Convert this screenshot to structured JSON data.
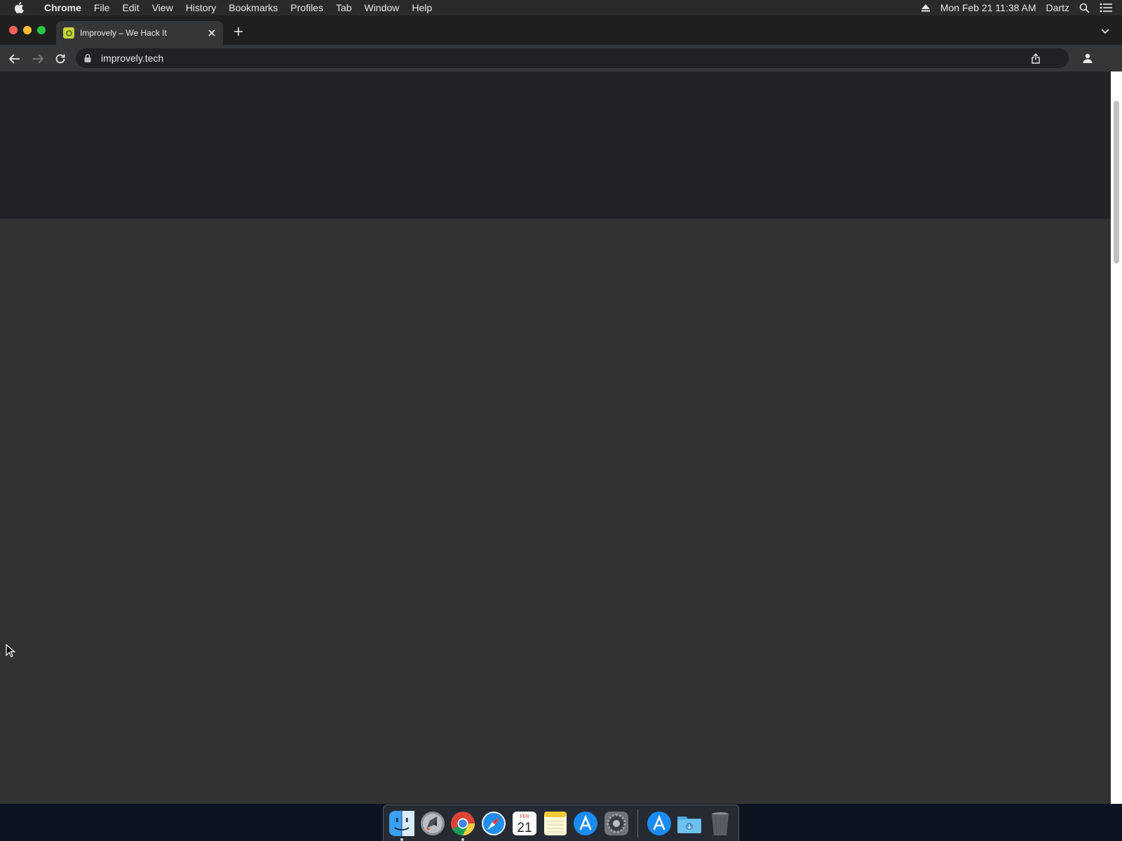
{
  "menubar": {
    "app_name": "Chrome",
    "items": [
      "File",
      "Edit",
      "View",
      "History",
      "Bookmarks",
      "Profiles",
      "Tab",
      "Window",
      "Help"
    ],
    "clock": "Mon Feb 21  11:38 AM",
    "user": "Dartz",
    "icons": [
      "apple-icon",
      "eject-icon",
      "spotlight-search-icon",
      "control-center-icon"
    ]
  },
  "browser": {
    "tab": {
      "title": "Improvely – We Hack It",
      "favicon": "improvely-favicon-icon"
    },
    "address_bar": {
      "url": "improvely.tech",
      "secure": true
    }
  },
  "dock": {
    "apps": [
      {
        "name": "Finder",
        "icon": "finder-icon",
        "running": true
      },
      {
        "name": "Launchpad",
        "icon": "launchpad-icon",
        "running": false
      },
      {
        "name": "Google Chrome",
        "icon": "chrome-icon",
        "running": true
      },
      {
        "name": "Safari",
        "icon": "safari-icon",
        "running": false
      },
      {
        "name": "Calendar",
        "icon": "calendar-icon",
        "running": false,
        "month": "FEB",
        "day": "21"
      },
      {
        "name": "Notes",
        "icon": "notes-icon",
        "running": false
      },
      {
        "name": "App Store",
        "icon": "app-store-icon",
        "running": false
      },
      {
        "name": "System Preferences",
        "icon": "system-preferences-icon",
        "running": false
      }
    ],
    "stack_items": [
      {
        "name": "Applications",
        "icon": "applications-folder-icon"
      },
      {
        "name": "Downloads",
        "icon": "downloads-folder-icon"
      },
      {
        "name": "Trash",
        "icon": "trash-icon"
      }
    ]
  },
  "colors": {
    "page_header_bg": "#212226",
    "page_body_bg": "#323232",
    "menubar_bg": "#2a2a2c"
  }
}
